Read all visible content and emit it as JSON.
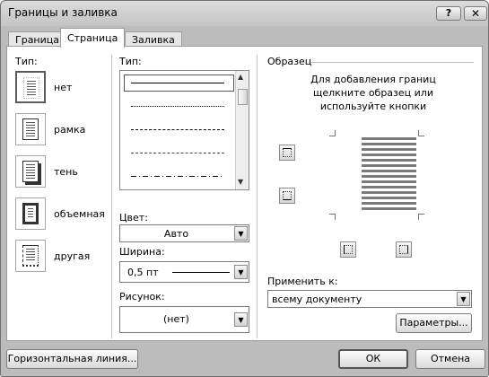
{
  "dialog": {
    "title": "Границы и заливка",
    "help_button": "?",
    "close_button": "✕"
  },
  "tabs": [
    {
      "label": "Граница"
    },
    {
      "label": "Страница"
    },
    {
      "label": "Заливка"
    }
  ],
  "settings": {
    "header": "Тип:",
    "items": [
      {
        "label": "нет"
      },
      {
        "label": "рамка"
      },
      {
        "label": "тень"
      },
      {
        "label": "объемная"
      },
      {
        "label": "другая"
      }
    ]
  },
  "style": {
    "header": "Тип:",
    "lines": [
      "solid",
      "dotted",
      "dashed",
      "dashed",
      "dash-dot"
    ],
    "color_label": "Цвет:",
    "color_value": "Авто",
    "width_label": "Ширина:",
    "width_value": "0,5 пт",
    "art_label": "Рисунок:",
    "art_value": "(нет)"
  },
  "preview": {
    "header": "Образец",
    "instruction": "Для добавления границ щелкните образец или используйте кнопки",
    "apply_label": "Применить к:",
    "apply_value": "всему документу",
    "options_button": "Параметры..."
  },
  "footer": {
    "hline_button": "Горизонтальная линия...",
    "ok_button": "ОК",
    "cancel_button": "Отмена"
  },
  "icons": {
    "top": "border-top-icon",
    "middle": "border-middle-icon",
    "left": "border-left-icon",
    "right": "border-right-icon",
    "dropdown": "chevron-down-icon"
  }
}
